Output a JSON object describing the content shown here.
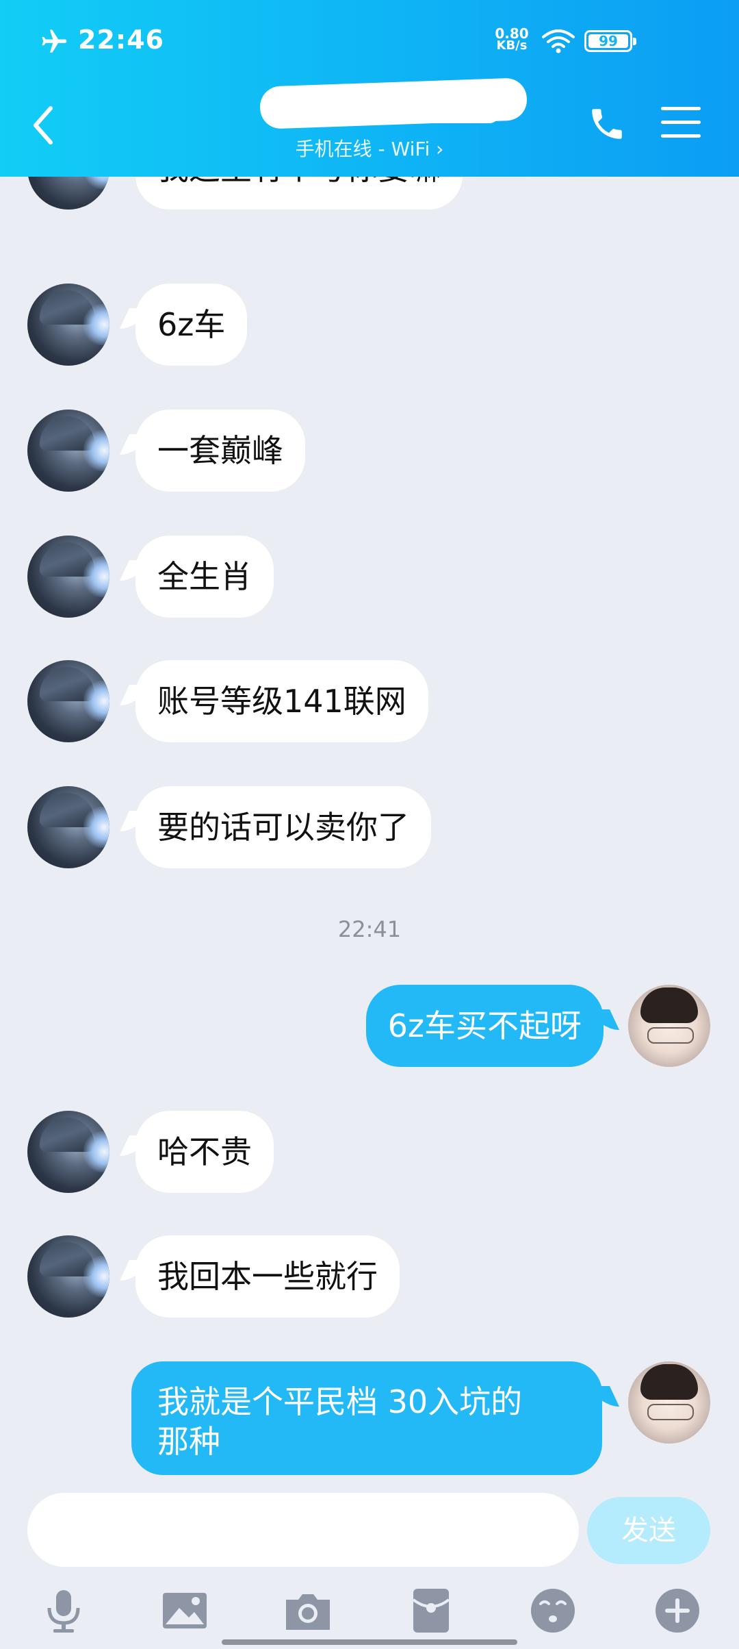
{
  "status_bar": {
    "time": "22:46",
    "net_speed_value": "0.80",
    "net_speed_unit": "KB/s",
    "battery": "99"
  },
  "header": {
    "subtitle": "手机在线 - WiFi ›"
  },
  "messages": [
    {
      "side": "in",
      "text": "我这里有个号你要嘛"
    },
    {
      "side": "in",
      "text": "6z车"
    },
    {
      "side": "in",
      "text": "一套巅峰"
    },
    {
      "side": "in",
      "text": "全生肖"
    },
    {
      "side": "in",
      "text": "账号等级141联网"
    },
    {
      "side": "in",
      "text": "要的话可以卖你了"
    },
    {
      "side": "out",
      "text": "6z车买不起呀"
    },
    {
      "side": "in",
      "text": "哈不贵"
    },
    {
      "side": "in",
      "text": "我回本一些就行"
    },
    {
      "side": "out",
      "text": "我就是个平民档 30入坑的",
      "text2": "那种"
    }
  ],
  "timestamp": "22:41",
  "input": {
    "value": "",
    "send_label": "发送"
  },
  "toolbar_icons": [
    "microphone-icon",
    "image-icon",
    "camera-icon",
    "red-packet-icon",
    "emoji-icon",
    "plus-icon"
  ],
  "colors": {
    "header_start": "#12cdf6",
    "header_end": "#0c9ef4",
    "outgoing_bubble": "#23b9f7",
    "incoming_bubble": "#ffffff",
    "background": "#eaedf4",
    "send_button_disabled": "#b4ebfd"
  }
}
